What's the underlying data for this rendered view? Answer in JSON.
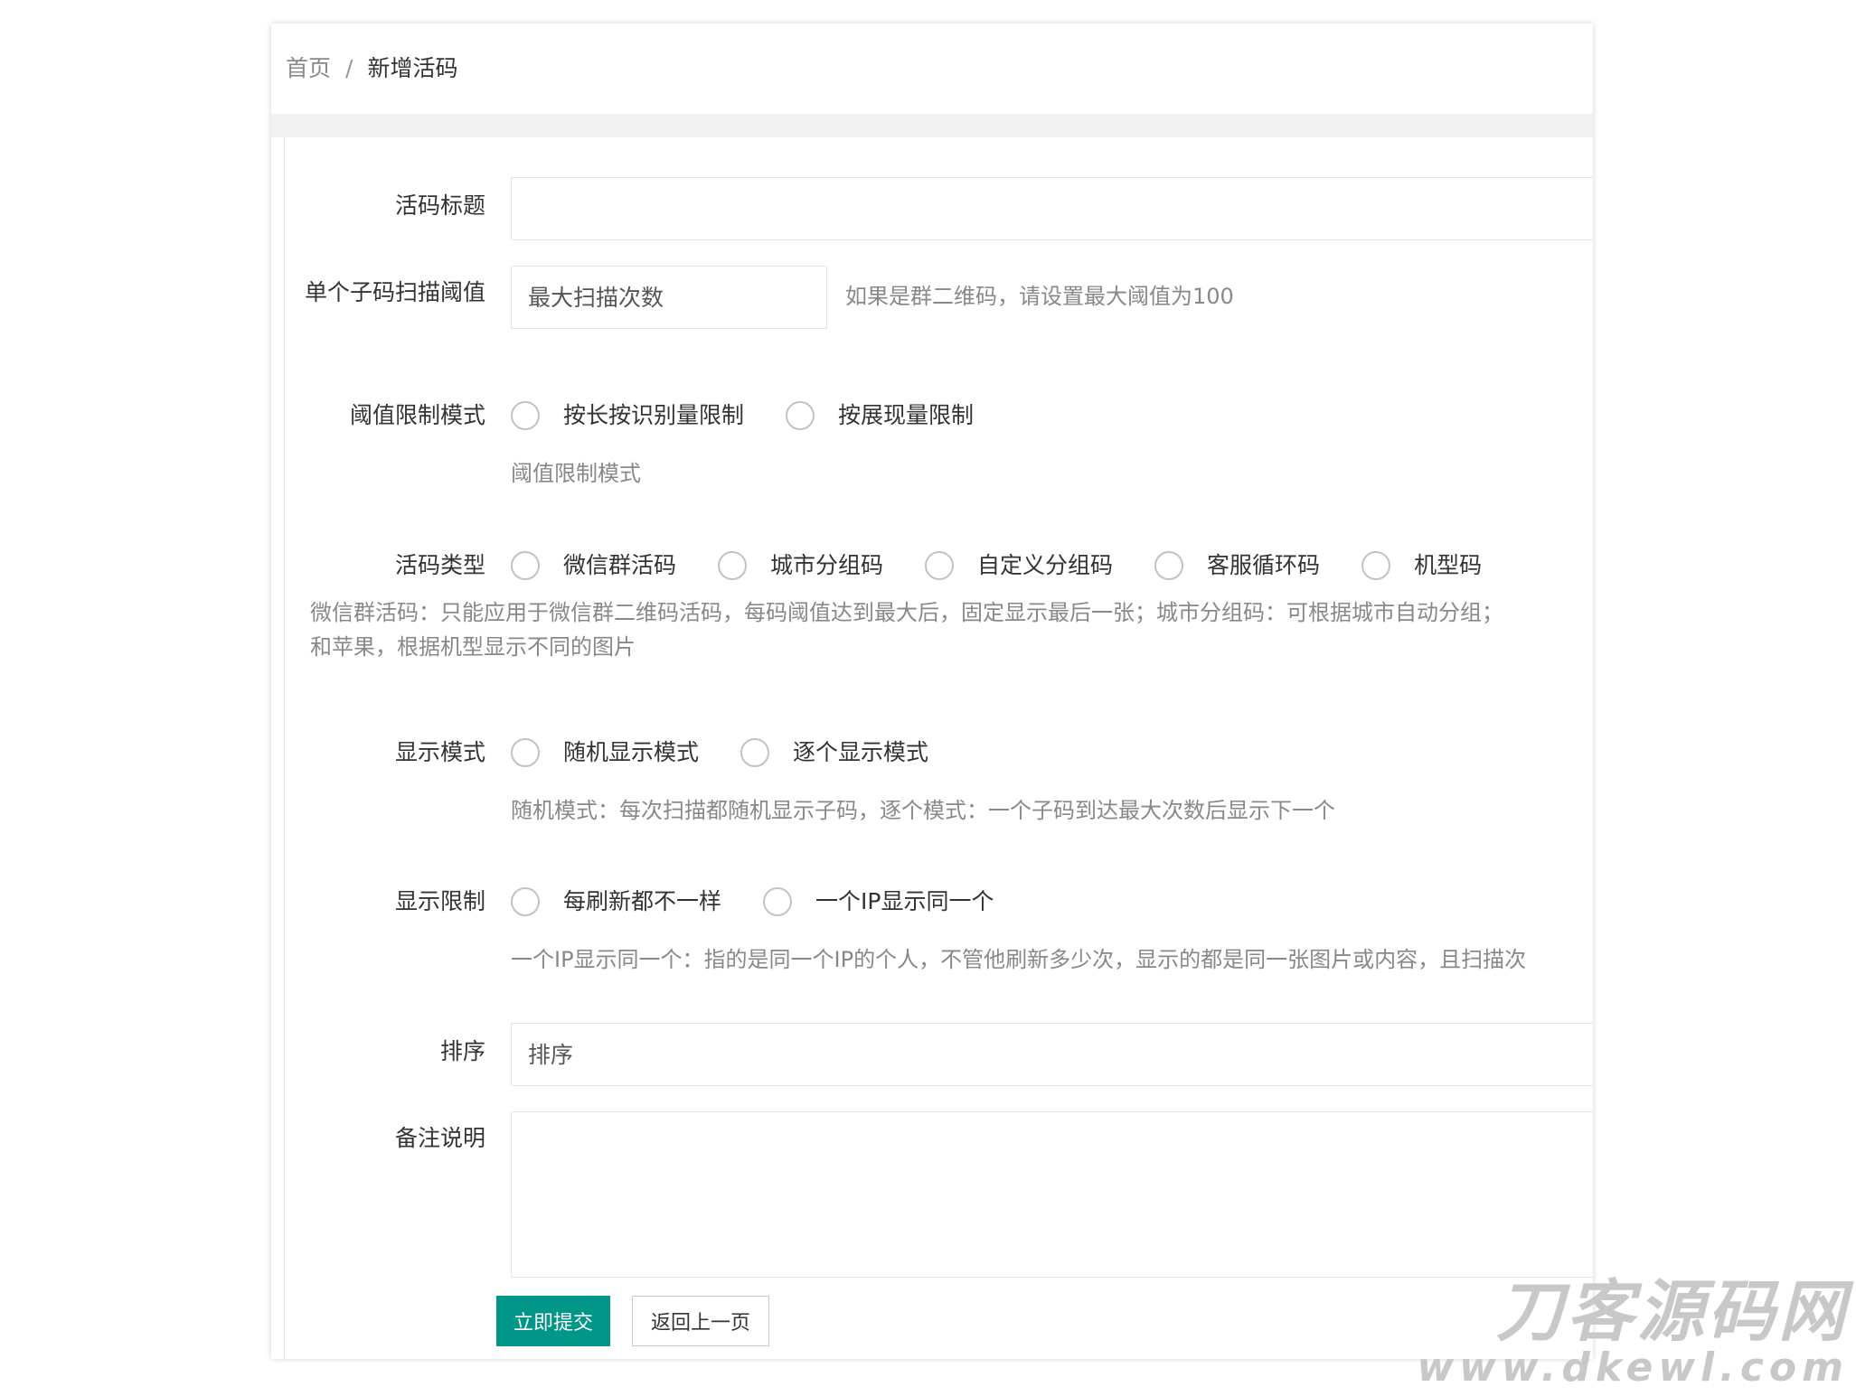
{
  "breadcrumb": {
    "home": "首页",
    "separator": "/",
    "current": "新增活码"
  },
  "form": {
    "title": {
      "label": "活码标题",
      "value": "",
      "placeholder": ""
    },
    "scan_threshold": {
      "label": "单个子码扫描阈值",
      "placeholder": "最大扫描次数",
      "hint": "如果是群二维码，请设置最大阈值为100"
    },
    "threshold_mode": {
      "label": "阈值限制模式",
      "options": [
        "按长按识别量限制",
        "按展现量限制"
      ],
      "hint": "阈值限制模式"
    },
    "code_type": {
      "label": "活码类型",
      "options": [
        "微信群活码",
        "城市分组码",
        "自定义分组码",
        "客服循环码",
        "机型码"
      ],
      "hint_line1": "微信群活码：只能应用于微信群二维码活码，每码阈值达到最大后，固定显示最后一张；城市分组码：可根据城市自动分组；",
      "hint_line2": "和苹果，根据机型显示不同的图片"
    },
    "display_mode": {
      "label": "显示模式",
      "options": [
        "随机显示模式",
        "逐个显示模式"
      ],
      "hint": "随机模式：每次扫描都随机显示子码，逐个模式：一个子码到达最大次数后显示下一个"
    },
    "display_limit": {
      "label": "显示限制",
      "options": [
        "每刷新都不一样",
        "一个IP显示同一个"
      ],
      "hint": "一个IP显示同一个：指的是同一个IP的个人，不管他刷新多少次，显示的都是同一张图片或内容，且扫描次"
    },
    "sort": {
      "label": "排序",
      "placeholder": "排序"
    },
    "remark": {
      "label": "备注说明",
      "value": ""
    }
  },
  "buttons": {
    "submit": "立即提交",
    "back": "返回上一页"
  },
  "watermark": {
    "main": "刀客源码网",
    "sub": "www.dkewl.com"
  },
  "colors": {
    "primary": "#009688",
    "hint": "#888888",
    "border": "#e6e6e6"
  }
}
